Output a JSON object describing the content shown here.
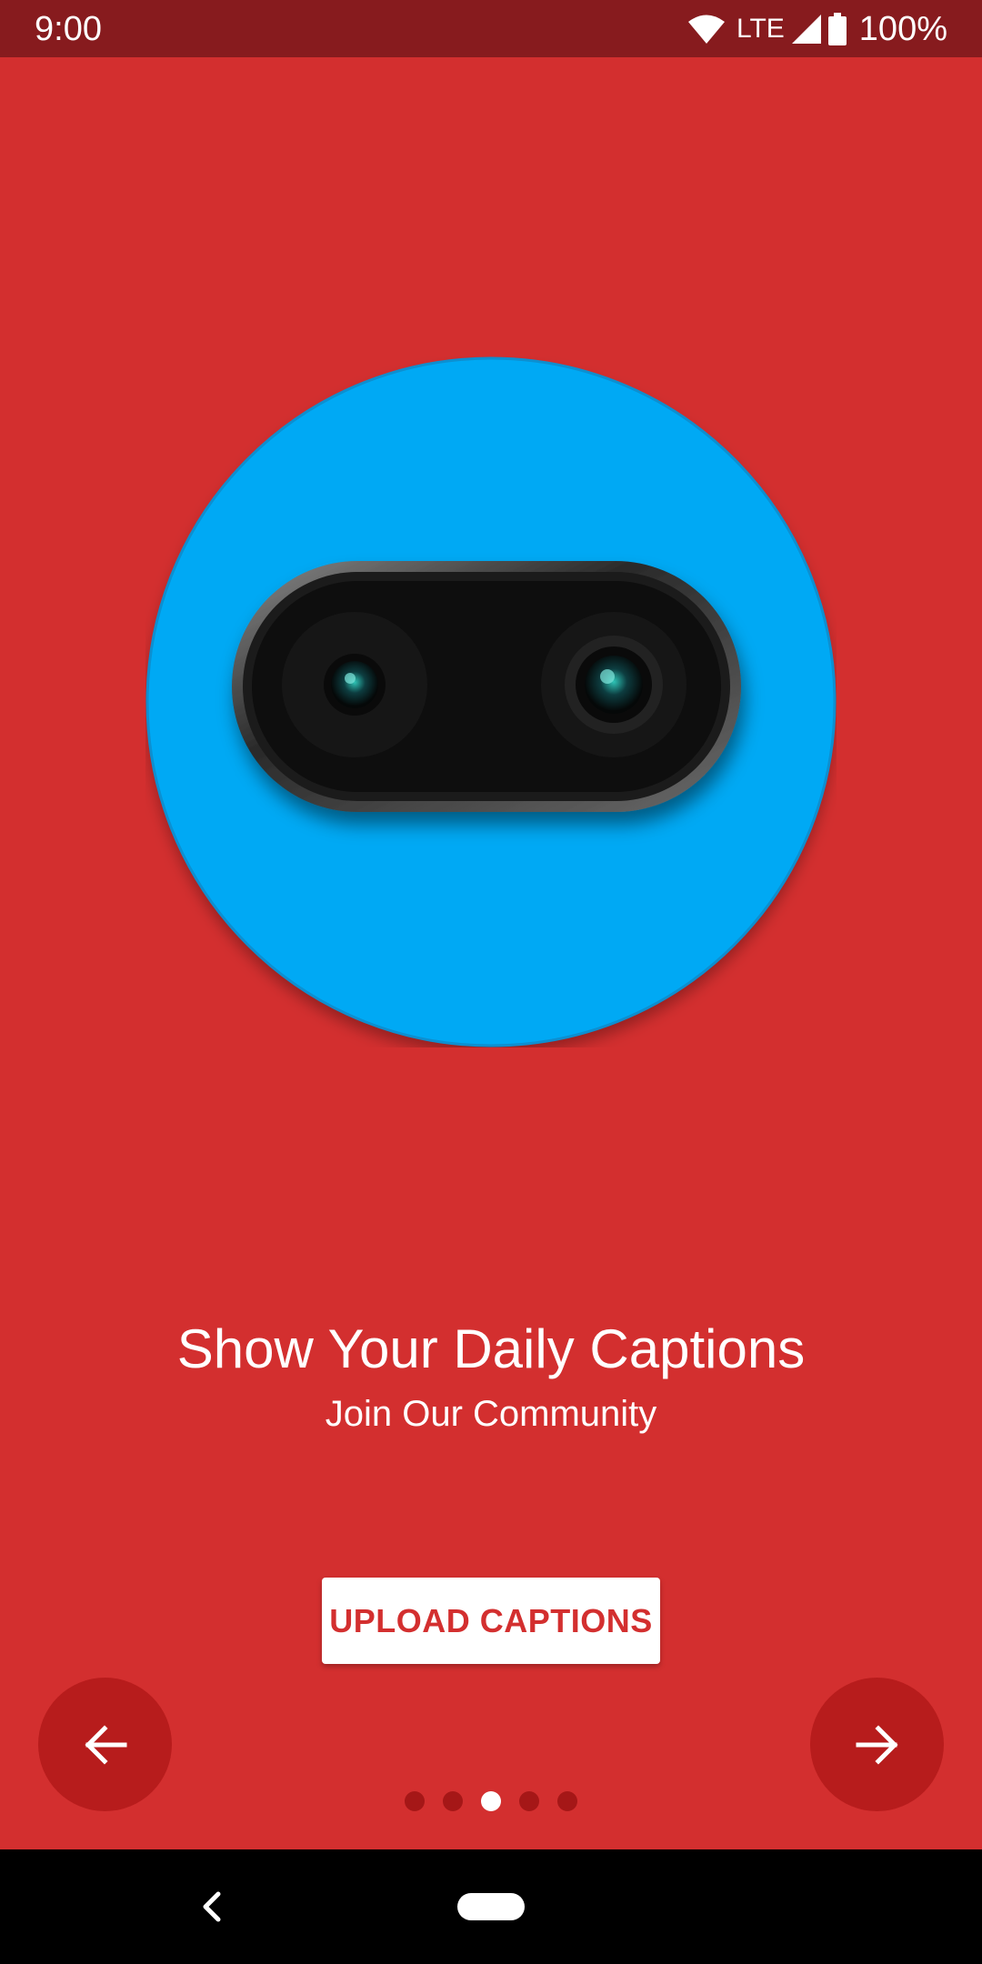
{
  "status_bar": {
    "time": "9:00",
    "network": "LTE",
    "battery": "100%",
    "icons": [
      "wifi-icon",
      "signal-icon",
      "battery-icon"
    ]
  },
  "onboarding": {
    "illustration": "dual-camera-illustration",
    "title": "Show Your Daily Captions",
    "subtitle": "Join Our Community",
    "cta_label": "UPLOAD CAPTIONS",
    "prev_icon": "arrow-left-icon",
    "next_icon": "arrow-right-icon",
    "pages_total": 5,
    "current_page": 3
  },
  "system_nav": {
    "back_icon": "back-chevron-icon",
    "home_icon": "home-pill-icon"
  },
  "colors": {
    "background": "#D32F2F",
    "status_bar": "#871B1E",
    "nav_button": "#B71C1C",
    "circle": "#03A9F4",
    "button_text": "#D32F2F"
  }
}
